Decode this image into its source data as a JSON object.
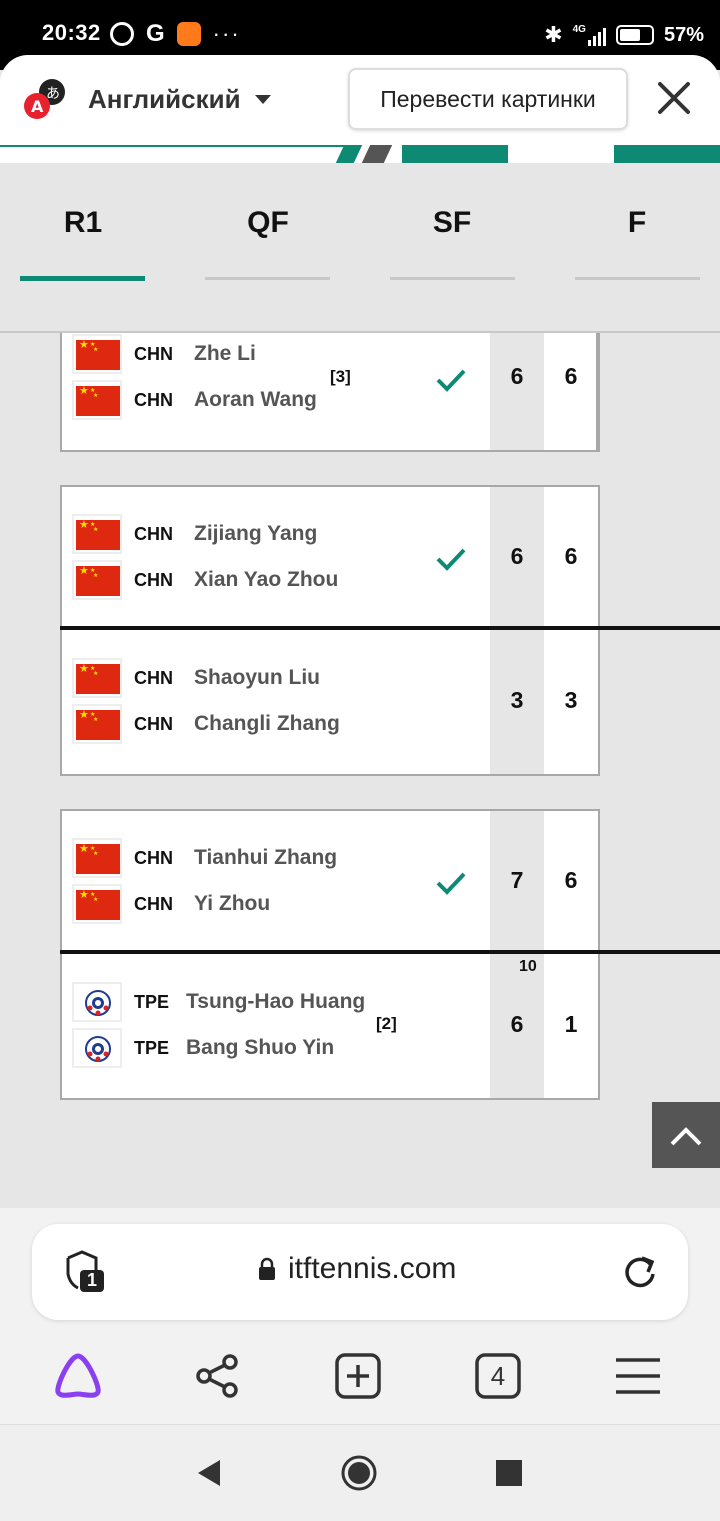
{
  "status_bar": {
    "time": "20:32",
    "network": "4G",
    "battery": "57%"
  },
  "translate_bar": {
    "language": "Английский",
    "translate_images_label": "Перевести картинки"
  },
  "rounds": {
    "tabs": [
      {
        "label": "R1",
        "active": true
      },
      {
        "label": "QF",
        "active": false
      },
      {
        "label": "SF",
        "active": false
      },
      {
        "label": "F",
        "active": false
      }
    ]
  },
  "matches": [
    {
      "players": [
        {
          "country": "CHN",
          "name": "Zhe Li"
        },
        {
          "country": "CHN",
          "name": "Aoran Wang"
        }
      ],
      "seed": "[3]",
      "winner": true,
      "scores": [
        "6",
        "6"
      ]
    },
    {
      "players": [
        {
          "country": "CHN",
          "name": "Zijiang Yang"
        },
        {
          "country": "CHN",
          "name": "Xian Yao Zhou"
        }
      ],
      "winner": true,
      "scores": [
        "6",
        "6"
      ]
    },
    {
      "players": [
        {
          "country": "CHN",
          "name": "Shaoyun Liu"
        },
        {
          "country": "CHN",
          "name": "Changli Zhang"
        }
      ],
      "winner": false,
      "scores": [
        "3",
        "3"
      ]
    },
    {
      "players": [
        {
          "country": "CHN",
          "name": "Tianhui Zhang"
        },
        {
          "country": "CHN",
          "name": "Yi Zhou"
        }
      ],
      "winner": true,
      "scores": [
        "7",
        "6"
      ]
    },
    {
      "players": [
        {
          "country": "TPE",
          "name": "Tsung-Hao Huang"
        },
        {
          "country": "TPE",
          "name": "Bang Shuo Yin"
        }
      ],
      "seed": "[2]",
      "winner": false,
      "tiebreak": "10",
      "scores": [
        "6",
        "1"
      ]
    }
  ],
  "browser": {
    "url": "itftennis.com",
    "tab_count": "4",
    "shield_count": "1"
  },
  "colors": {
    "accent_green": "#0e8a74",
    "alice_purple": "#8a3ff0"
  }
}
